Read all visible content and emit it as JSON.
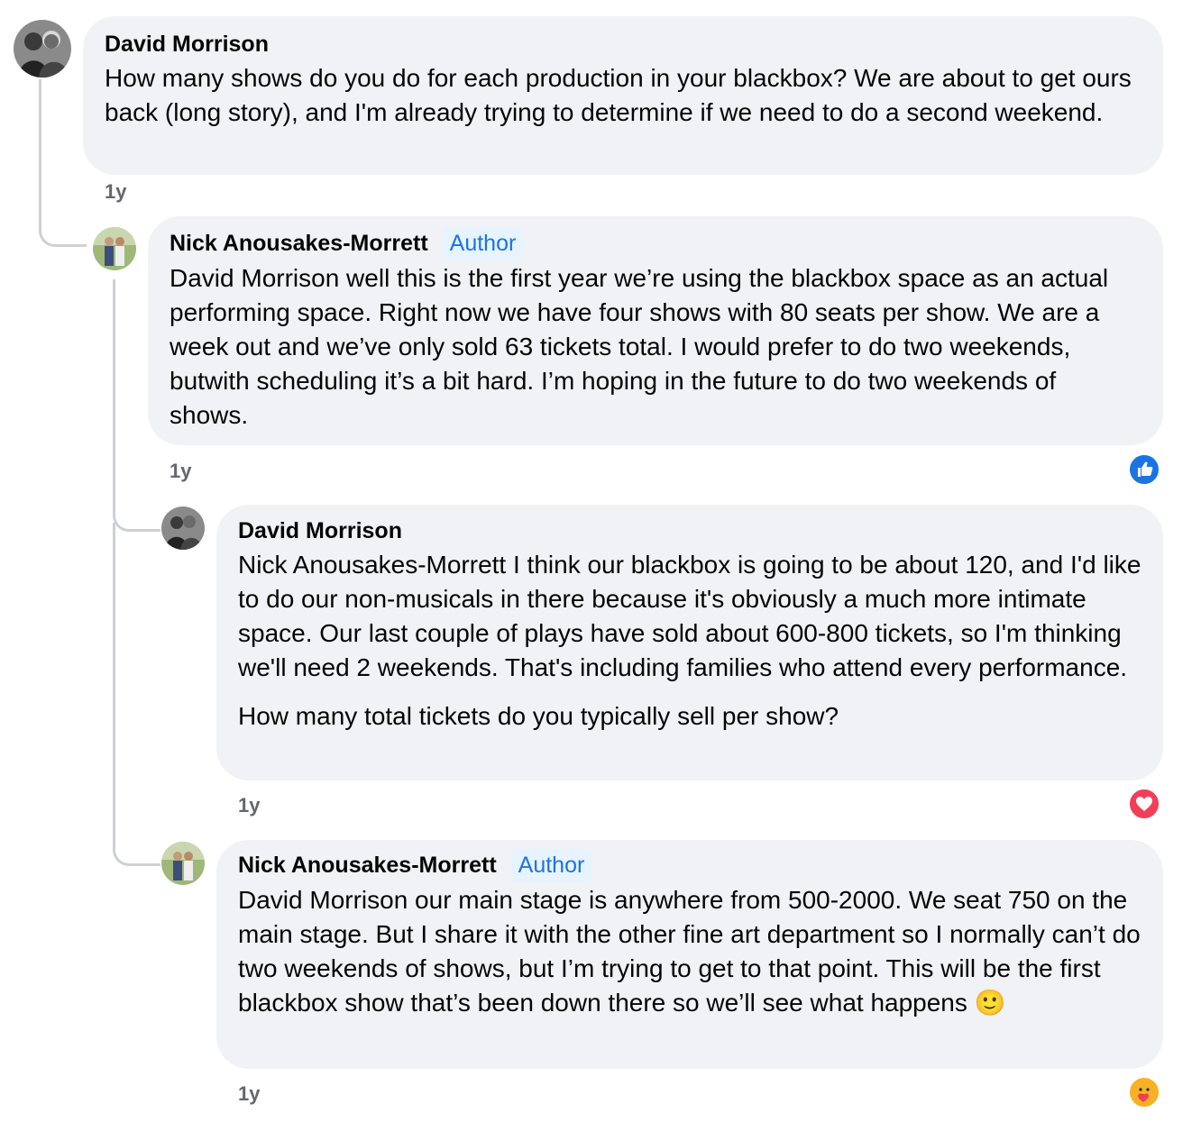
{
  "comments": [
    {
      "author": "David Morrison",
      "text": "How many shows do you do for each production in your blackbox? We are about to get ours back (long story), and I'm already trying to determine if we need to do a second weekend.",
      "time": "1y"
    },
    {
      "author": "Nick Anousakes-Morrett",
      "badge": "Author",
      "text": "David Morrison well this is the first year we’re using the blackbox space as an actual performing space. Right now we have four shows with 80 seats per show. We are a week out and we’ve only sold 63 tickets total. I would prefer to do two weekends, butwith scheduling it’s a bit hard. I’m hoping in the future to do two weekends of shows.",
      "time": "1y",
      "reaction": "like-icon"
    },
    {
      "author": "David Morrison",
      "text": "Nick Anousakes-Morrett I think our blackbox is going to be about 120, and I'd like to do our non-musicals in there because it's obviously a much more intimate space. Our last couple of plays have sold about 600-800 tickets, so I'm thinking we'll need 2 weekends. That's including families who attend every performance.",
      "text2": "How many total tickets do you typically sell per show?",
      "time": "1y",
      "reaction": "love-icon"
    },
    {
      "author": "Nick Anousakes-Morrett",
      "badge": "Author",
      "text": "David Morrison our main stage is anywhere from 500-2000. We seat 750 on the main stage. But I share it with the other fine art department so I normally can’t do two weekends of shows, but I’m trying to get to that point. This will be the first blackbox show that’s been down there so we’ll see what happens",
      "emoji": "🙂",
      "time": "1y",
      "reaction": "care-icon"
    }
  ],
  "colors": {
    "bubble": "#f0f2f5",
    "author_badge": "#1b74e4",
    "like": "#1b74e4",
    "love": "#f33e58",
    "care": "#f7b125"
  }
}
